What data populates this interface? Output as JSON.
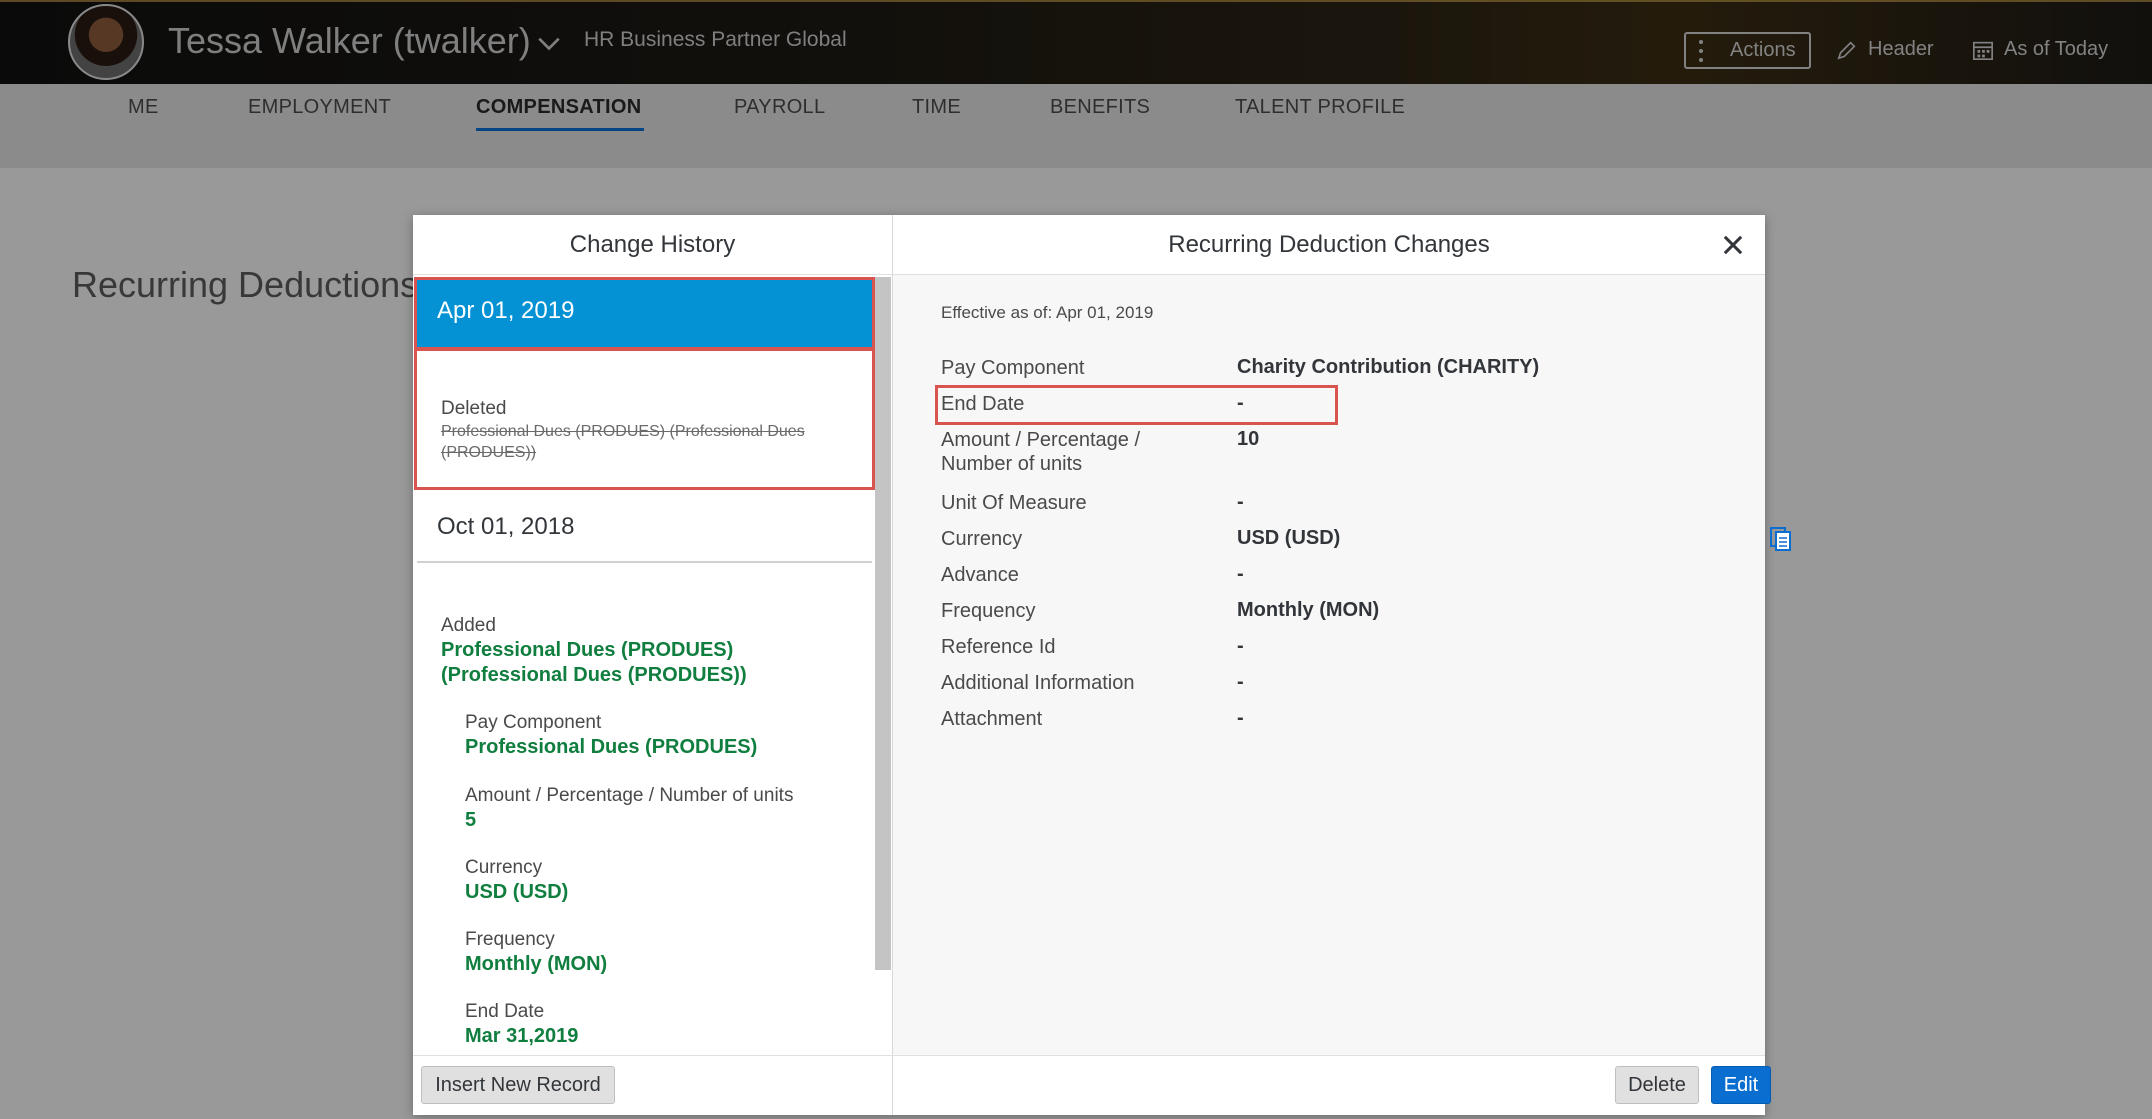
{
  "header": {
    "user_name": "Tessa Walker (twalker)",
    "user_role": "HR Business Partner Global",
    "actions_label": "Actions",
    "header_label": "Header",
    "as_of_label": "As of Today"
  },
  "tabs": [
    "ME",
    "EMPLOYMENT",
    "COMPENSATION",
    "PAYROLL",
    "TIME",
    "BENEFITS",
    "TALENT PROFILE"
  ],
  "active_tab": "COMPENSATION",
  "section_title": "Recurring Deductions",
  "dialog": {
    "left_title": "Change History",
    "right_title": "Recurring Deduction Changes",
    "history": [
      {
        "date": "Apr 01, 2019",
        "action": "Deleted",
        "item": "Professional Dues (PRODUES) (Professional Dues (PRODUES))"
      },
      {
        "date": "Oct 01, 2018",
        "action": "Added",
        "item_line1": "Professional Dues (PRODUES)",
        "item_line2": "(Professional Dues (PRODUES))",
        "fields": [
          {
            "label": "Pay Component",
            "value": "Professional Dues (PRODUES)"
          },
          {
            "label": "Amount / Percentage / Number of units",
            "value": "5"
          },
          {
            "label": "Currency",
            "value": "USD (USD)"
          },
          {
            "label": "Frequency",
            "value": "Monthly (MON)"
          },
          {
            "label": "End Date",
            "value": "Mar 31,2019"
          }
        ]
      }
    ],
    "insert_label": "Insert New Record",
    "effective": "Effective as of: Apr 01, 2019",
    "details": {
      "pay_component_label": "Pay Component",
      "pay_component_value": "Charity Contribution (CHARITY)",
      "end_date_label": "End Date",
      "end_date_value": "-",
      "amount_label_1": "Amount / Percentage /",
      "amount_label_2": "Number of units",
      "amount_value": "10",
      "uom_label": "Unit Of Measure",
      "uom_value": "-",
      "currency_label": "Currency",
      "currency_value": "USD (USD)",
      "advance_label": "Advance",
      "advance_value": "-",
      "frequency_label": "Frequency",
      "frequency_value": "Monthly (MON)",
      "reference_label": "Reference Id",
      "reference_value": "-",
      "additional_label": "Additional Information",
      "additional_value": "-",
      "attachment_label": "Attachment",
      "attachment_value": "-"
    },
    "delete_label": "Delete",
    "edit_label": "Edit"
  },
  "colors": {
    "accent": "#0a6ed1",
    "selected": "#0492d5",
    "added_green": "#107e3e",
    "highlight_red": "#d9534f"
  },
  "icons": [
    "chevron-down-icon",
    "more-vertical-icon",
    "pencil-icon",
    "calendar-icon",
    "close-icon",
    "copy-icon"
  ]
}
